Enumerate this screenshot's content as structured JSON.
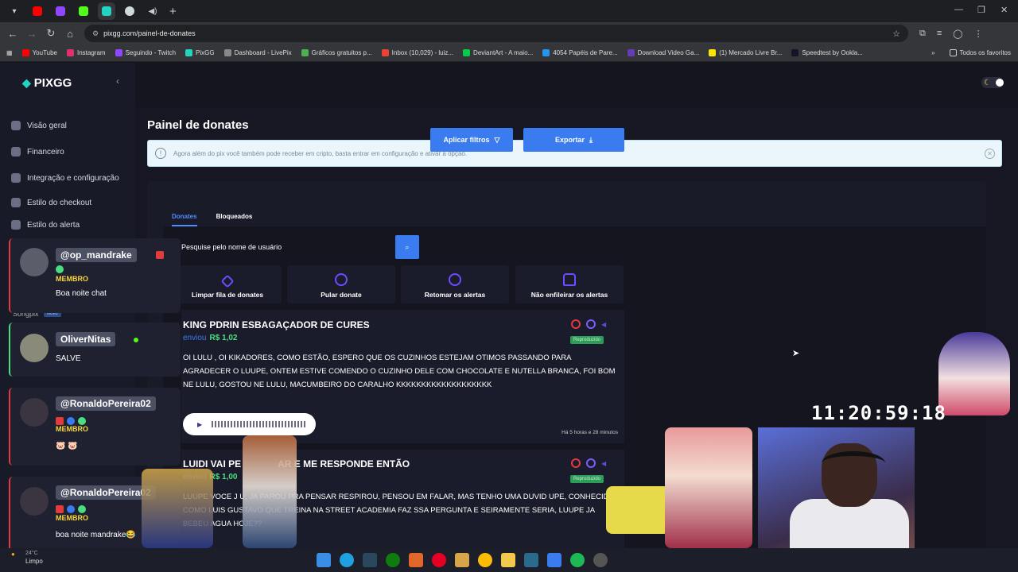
{
  "browser": {
    "url": "pixgg.com/painel-de-donates"
  },
  "bookmarks": [
    {
      "label": "YouTube",
      "color": "#ff0000"
    },
    {
      "label": "Instagram",
      "color": "#e1306c"
    },
    {
      "label": "Seguindo - Twitch",
      "color": "#9146ff"
    },
    {
      "label": "PixGG",
      "color": "#22d3c0"
    },
    {
      "label": "Dashboard - LivePix",
      "color": "#888888"
    },
    {
      "label": "Gráficos gratuitos p...",
      "color": "#4caf50"
    },
    {
      "label": "Inbox (10,029) - luiz...",
      "color": "#ea4335"
    },
    {
      "label": "DeviantArt - A maio...",
      "color": "#05cc47"
    },
    {
      "label": "4054 Papéis de Pare...",
      "color": "#2196f3"
    },
    {
      "label": "Download Video Ga...",
      "color": "#673ab7"
    },
    {
      "label": "(1) Mercado Livre Br...",
      "color": "#ffe600"
    },
    {
      "label": "Speedtest by Ookla...",
      "color": "#141526"
    }
  ],
  "bookmarks_all": "Todos os favoritos",
  "app": {
    "logo": "PIXGG"
  },
  "sidebar": {
    "items": [
      {
        "label": "Visão geral"
      },
      {
        "label": "Financeiro"
      },
      {
        "label": "Integração e configuração"
      },
      {
        "label": "Estilo do checkout"
      },
      {
        "label": "Estilo do alerta"
      },
      {
        "label": "Songpix",
        "badge": "Novo"
      }
    ]
  },
  "page": {
    "title": "Painel de donates",
    "alert": "Agora além do pix você também pode receber em cripto, basta entrar em configuração e ativar a opção.",
    "tabs": [
      "Donates",
      "Bloqueados"
    ],
    "search_placeholder": "Pesquise pelo nome de usuário",
    "apply_filters": "Aplicar filtros",
    "export": "Exportar",
    "actions": [
      "Limpar fila de donates",
      "Pular donate",
      "Retomar os alertas",
      "Não enfileirar os alertas"
    ]
  },
  "donates": [
    {
      "name": "KING PDRIN ESBAGAÇADOR DE CURES",
      "sent": "enviou",
      "amount": "R$ 1,02",
      "status": "Reproduzido",
      "message": "OI LULU , OI KIKADORES, COMO ESTÃO, ESPERO QUE OS CUZINHOS ESTEJAM OTIMOS PASSANDO PARA AGRADECER O LUUPE, ONTEM ESTIVE COMENDO O CUZINHO DELE COM CHOCOLATE E NUTELLA BRANCA, FOI BOM NE LULU, GOSTOU NE LULU, MACUMBEIRO DO CARALHO KKKKKKKKKKKKKKKKKKK",
      "time": "Há 5 horas e 28 minutos"
    },
    {
      "name": "LUIDI VAI PE",
      "name_tail": "AR E ME RESPONDE ENTÃO",
      "sent": "enviou",
      "amount": "R$ 1,00",
      "status": "Reproduzido",
      "message": "LUUPE VOCE J       U, JA PAROU PRA PENSAR RESPIROU, PENSOU EM FALAR, MAS TENHO UMA DUVID         UPE, CONHECIDO COMO LUIS GUSTAVO QUE TREINA NA STREET ACADEMIA FAZ        SSA PERGUNTA E SEIRAMENTE SERIA, LUUPE JA BEBEU AGUA HOJE??"
    }
  ],
  "chat": [
    {
      "user": "@op_mandrake",
      "badge": "MEMBRO",
      "message": "Boa noite chat"
    },
    {
      "user": "OliverNitas",
      "message": "SALVE"
    },
    {
      "user": "@RonaldoPereira02",
      "badge": "MEMBRO",
      "message": "🐷 🐷"
    },
    {
      "user": "@RonaldoPereira02",
      "badge": "MEMBRO",
      "message": "boa noite mandrake😂"
    }
  ],
  "overlay": {
    "clock": "11:20:59:18"
  },
  "weather": {
    "temp": "24°C",
    "condition": "Limpo"
  }
}
